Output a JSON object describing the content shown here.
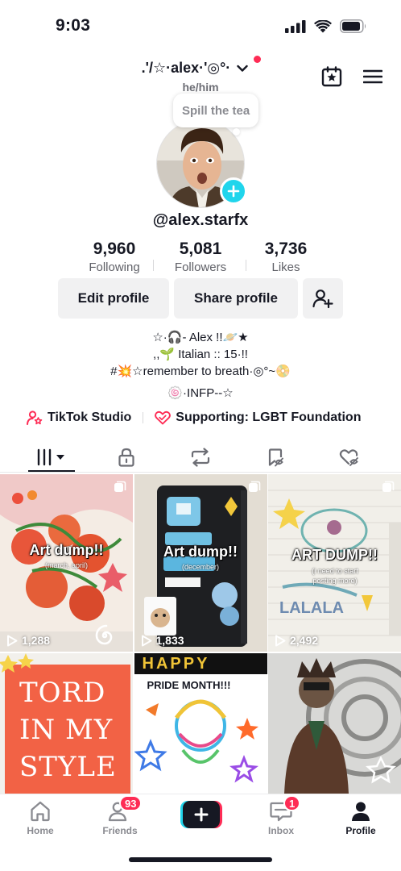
{
  "status_bar": {
    "time": "9:03"
  },
  "header": {
    "display_name": ".'/☆·alex·'◎°·",
    "pronouns": "he/him",
    "note": "Spill the tea"
  },
  "profile": {
    "handle": "@alex.starfx"
  },
  "stats": {
    "following": {
      "value": "9,960",
      "label": "Following"
    },
    "followers": {
      "value": "5,081",
      "label": "Followers"
    },
    "likes": {
      "value": "3,736",
      "label": "Likes"
    }
  },
  "actions": {
    "edit_label": "Edit profile",
    "share_label": "Share profile"
  },
  "bio": {
    "lines": [
      "☆·🎧- Alex !!🪐★",
      ",,🌱 Italian :: 15·!!",
      "#💥☆remember to breath·◎°~📀"
    ],
    "extra": "🍥·INFP--☆"
  },
  "links": {
    "studio": "TikTok Studio",
    "supporting": "Supporting: LGBT Foundation"
  },
  "tabs": [
    "videos-tab",
    "private-tab",
    "reposts-tab",
    "favorites-tab",
    "liked-tab"
  ],
  "videos": [
    {
      "title": "Art dump!!",
      "subtitle": "(march, april)",
      "views": "1,288"
    },
    {
      "title": "Art dump!!",
      "subtitle": "(december)",
      "views": "1,833"
    },
    {
      "title": "ART DUMP!!",
      "subtitle": "(i need to start posting more)",
      "views": "2,492"
    },
    {
      "title": "TORD IN MY STYLE",
      "subtitle": "",
      "views": ""
    },
    {
      "title": "HAPPY",
      "subtitle": "PRIDE MONTH!!!",
      "views": ""
    },
    {
      "title": "",
      "subtitle": "",
      "views": ""
    }
  ],
  "nav": {
    "home": "Home",
    "friends": "Friends",
    "friends_badge": "93",
    "inbox": "Inbox",
    "inbox_badge": "1",
    "profile": "Profile"
  },
  "colors": {
    "accent_pink": "#fe2c55",
    "accent_cyan": "#20d5ec",
    "text": "#161823",
    "button_bg": "#f1f1f2"
  }
}
